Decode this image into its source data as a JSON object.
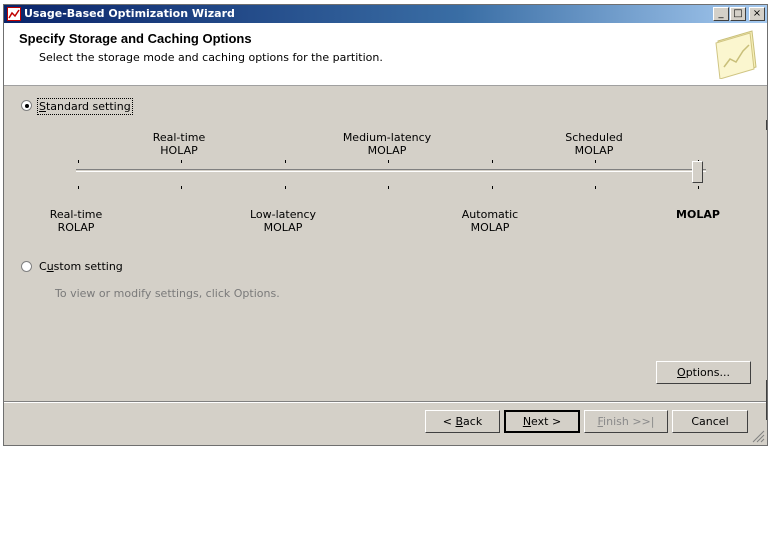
{
  "window": {
    "title": "Usage-Based Optimization Wizard",
    "controls": {
      "minimize": "_",
      "maximize": "□",
      "close": "×"
    }
  },
  "header": {
    "title": "Specify Storage and Caching Options",
    "subtitle": "Select the storage mode and caching options for the partition."
  },
  "options": {
    "standard": {
      "label": "Standard setting",
      "checked": true
    },
    "custom": {
      "label": "Custom setting",
      "checked": false,
      "hint": "To view or modify settings, click Options."
    }
  },
  "slider": {
    "selected_index": 6,
    "top_labels": [
      {
        "line1": "Real-time",
        "line2": "HOLAP"
      },
      {
        "line1": "Medium-latency",
        "line2": "MOLAP"
      },
      {
        "line1": "Scheduled",
        "line2": "MOLAP"
      }
    ],
    "bottom_labels": [
      {
        "line1": "Real-time",
        "line2": "ROLAP"
      },
      {
        "line1": "Low-latency",
        "line2": "MOLAP"
      },
      {
        "line1": "Automatic",
        "line2": "MOLAP"
      },
      {
        "line1": "MOLAP",
        "line2": ""
      }
    ]
  },
  "buttons": {
    "options": "Options...",
    "back": "< Back",
    "next": "Next >",
    "finish": "Finish >>|",
    "cancel": "Cancel"
  }
}
